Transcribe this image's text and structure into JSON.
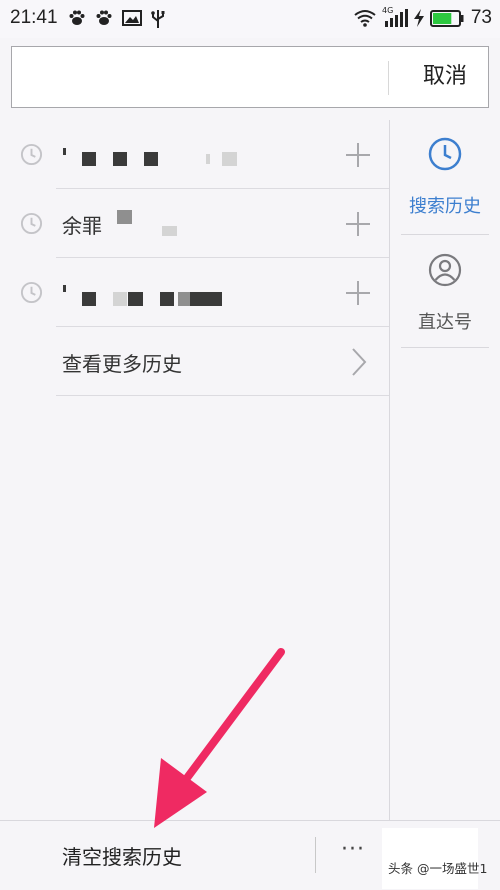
{
  "status_bar": {
    "time": "21:41",
    "left_icons": [
      "paw-icon",
      "paw-icon",
      "image-icon",
      "usb-icon"
    ],
    "network": "4G",
    "battery_percent": "73",
    "battery_level": 0.73
  },
  "search": {
    "input_value": "",
    "cancel_label": "取消"
  },
  "history": {
    "items": [
      {
        "text": "",
        "redacted": true
      },
      {
        "text": "余罪",
        "redacted": true
      },
      {
        "text": "",
        "redacted": true
      }
    ],
    "more_label": "查看更多历史"
  },
  "sidebar": {
    "items": [
      {
        "label": "搜索历史",
        "icon": "clock-icon",
        "active": true
      },
      {
        "label": "直达号",
        "icon": "person-icon",
        "active": false
      }
    ]
  },
  "bottom": {
    "clear_label": "清空搜索历史",
    "more_label": "···"
  },
  "watermark": "头条 @一场盛世1",
  "colors": {
    "accent": "#3d7fcf",
    "arrow": "#ef2a62",
    "battery": "#2dc840"
  }
}
